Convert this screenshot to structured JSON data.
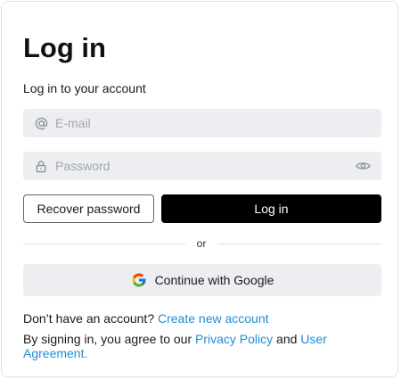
{
  "title": "Log in",
  "subtitle": "Log in to your account",
  "email": {
    "placeholder": "E-mail",
    "icon": "at-icon"
  },
  "password": {
    "placeholder": "Password",
    "icon": "lock-icon",
    "toggle_icon": "eye-icon"
  },
  "buttons": {
    "recover": "Recover password",
    "login": "Log in",
    "google": "Continue with Google"
  },
  "divider_text": "or",
  "signup": {
    "prompt": "Don’t have an account?",
    "link": "Create new account"
  },
  "terms": {
    "prefix": "By signing in, you agree to our",
    "privacy_link": "Privacy Policy",
    "and": "and",
    "agreement_link": "User Agreement."
  },
  "colors": {
    "primary_button": "#000000",
    "link": "#1a8fd6",
    "input_background": "#eceef1"
  }
}
